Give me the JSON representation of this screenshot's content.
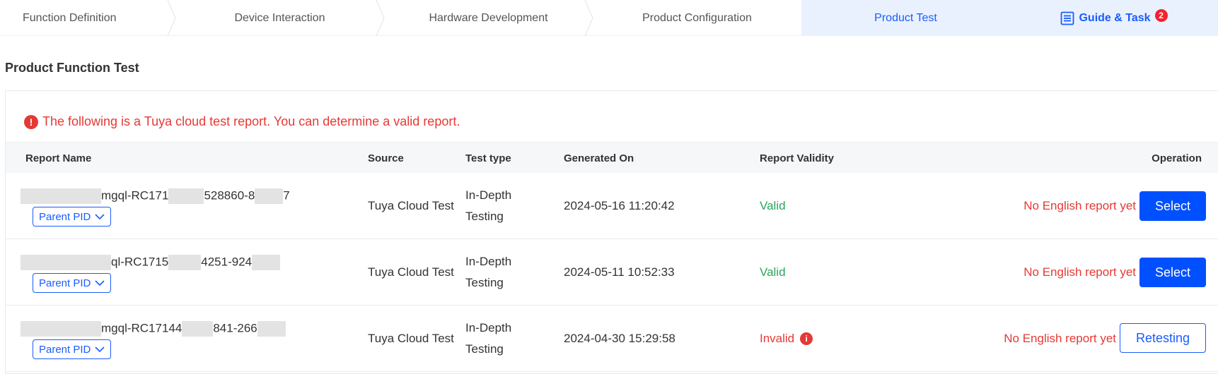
{
  "steps": [
    {
      "label": "Function Definition"
    },
    {
      "label": "Device Interaction"
    },
    {
      "label": "Hardware Development"
    },
    {
      "label": "Product Configuration"
    },
    {
      "label": "Product Test"
    }
  ],
  "guide": {
    "label": "Guide & Task",
    "badge": "2"
  },
  "page_title": "Product Function Test",
  "alert": {
    "text": "The following is a Tuya cloud test report. You can determine a valid report."
  },
  "table": {
    "headers": {
      "report_name": "Report Name",
      "source": "Source",
      "test_type": "Test type",
      "generated_on": "Generated On",
      "validity": "Report Validity",
      "operation": "Operation"
    },
    "rows": [
      {
        "name_a": "mgql-RC171",
        "name_b": "528860-8",
        "name_c": "7",
        "pid_label": "Parent PID",
        "source": "Tuya Cloud Test",
        "test_type_1": "In-Depth",
        "test_type_2": "Testing",
        "generated_on": "2024-05-16 11:20:42",
        "validity": "Valid",
        "english": "No English report yet",
        "action": "Select"
      },
      {
        "name_a": "ql-RC1715",
        "name_b": "4251-924",
        "name_c": "",
        "pid_label": "Parent PID",
        "source": "Tuya Cloud Test",
        "test_type_1": "In-Depth",
        "test_type_2": "Testing",
        "generated_on": "2024-05-11 10:52:33",
        "validity": "Valid",
        "english": "No English report yet",
        "action": "Select"
      },
      {
        "name_a": "mgql-RC17144",
        "name_b": "841-266",
        "name_c": "",
        "pid_label": "Parent PID",
        "source": "Tuya Cloud Test",
        "test_type_1": "In-Depth",
        "test_type_2": "Testing",
        "generated_on": "2024-04-30 15:29:58",
        "validity": "Invalid",
        "english": "No English report yet",
        "action": "Retesting"
      }
    ]
  },
  "colors": {
    "primary": "#0050ff",
    "valid": "#2aa55a",
    "error": "#e53935",
    "active_step_bg": "#e9f1ff"
  }
}
